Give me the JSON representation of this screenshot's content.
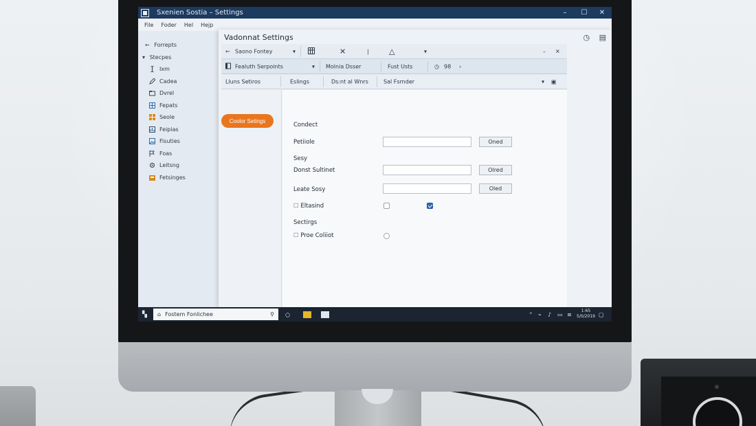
{
  "window": {
    "title": "Sxenien Sostia – Settings",
    "controls": [
      "–",
      "☐",
      "✕"
    ]
  },
  "menubar": [
    "File",
    "Foder",
    "Hel",
    "Hejp"
  ],
  "sidebar": {
    "back_label": "Forrepts",
    "tree_label": "Stecpes",
    "items": [
      {
        "label": "Ixm",
        "icon": "text-cursor-icon",
        "color": "#3b4a5c"
      },
      {
        "label": "Cadea",
        "icon": "pencil-icon",
        "color": "#3b4a5c"
      },
      {
        "label": "Dvrel",
        "icon": "folder-icon",
        "color": "#3b4a5c"
      },
      {
        "label": "Fepats",
        "icon": "grid-icon",
        "color": "#2f6fb0"
      },
      {
        "label": "Seole",
        "icon": "grid-icon",
        "color": "#d88a1c"
      },
      {
        "label": "Feipias",
        "icon": "chart-icon",
        "color": "#3b4a5c"
      },
      {
        "label": "Fisuties",
        "icon": "image-icon",
        "color": "#2f6fb0"
      },
      {
        "label": "Foas",
        "icon": "flag-icon",
        "color": "#3b4a5c"
      },
      {
        "label": "Leitsng",
        "icon": "gear-icon",
        "color": "#3b4a5c"
      },
      {
        "label": "Fetsinges",
        "icon": "box-icon",
        "color": "#d88a1c"
      }
    ]
  },
  "dialog": {
    "title": "Vadonnat Settings",
    "toolbar1": {
      "back_label": "Saono Fontey",
      "icons": [
        "sliders-icon",
        "close-x-icon",
        "triangle-icon"
      ],
      "minimize": "–",
      "close": "✕"
    },
    "toolbar2": {
      "item1": "Fealuth Serpoints",
      "item2": "Molnia Dsser",
      "item3": "Fust Usts",
      "zoom": "98"
    },
    "tabs": [
      "Lluns Setiros",
      "Eslings",
      "Ds:nt al Wnrs",
      "Sal Fsrnder"
    ],
    "side_button": "Coolor Setings",
    "content": {
      "heading1": "Condect",
      "row1_label": "Petiiole",
      "row1_button": "Oned",
      "heading2": "Sesy",
      "row2_label": "Donst Sultinet",
      "row2_button": "Olred",
      "row3_label": "Leate Sosy",
      "row3_button": "Oled",
      "check1_label": "Eltasind",
      "heading3": "Sectirgs",
      "check2_label": "Proe Coliiot"
    }
  },
  "taskbar": {
    "search_text": "Fostem Fonlichee",
    "clock_top": "1:65",
    "clock_bottom": "5/0/2019"
  },
  "colors": {
    "accent": "#e9761f",
    "titlebar": "#1d3a5f",
    "checkbox_checked": "#2b6cc0"
  }
}
